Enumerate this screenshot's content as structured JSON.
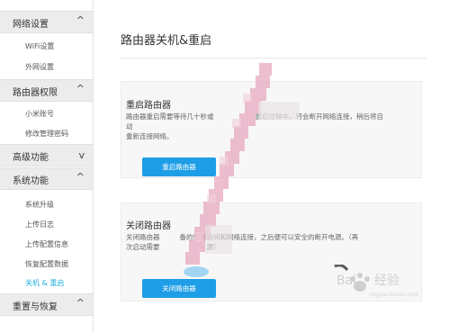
{
  "sidebar": {
    "sections": [
      {
        "label": "网络设置",
        "chevron": "^",
        "items": [
          "WiFi设置",
          "外网设置"
        ]
      },
      {
        "label": "路由器权限",
        "chevron": "^",
        "items": [
          "小米账号",
          "修改管理密码"
        ]
      },
      {
        "label": "高级功能",
        "chevron": "v",
        "items": []
      },
      {
        "label": "系统功能",
        "chevron": "^",
        "items": [
          "系统升级",
          "上传日志",
          "上传配置信息",
          "恢复配置数据",
          "关机 & 重启"
        ]
      },
      {
        "label": "重置与恢复",
        "chevron": "^",
        "items": []
      }
    ],
    "active_item": "关机 & 重启"
  },
  "main": {
    "title": "路由器关机&重启",
    "restart": {
      "title": "重启路由器",
      "desc_line1": "路由器重启需要等待几十秒或",
      "desc_line1b": "重启过程中，将会断开网络连接，稍后将自动",
      "desc_line2": "重新连接网络。",
      "button": "重启路由器"
    },
    "shutdown": {
      "title": "关闭路由器",
      "desc_line1a": "关闭路由器",
      "desc_line1b": "备的数据访问和网络连接，之后便可以安全的断开电源。（再",
      "desc_line2a": "次启动需要",
      "desc_line2b": "源）",
      "button": "关闭路由器"
    }
  },
  "watermark": {
    "text": "Bai 经验",
    "sub": "jingyan.baidu.com"
  },
  "colors": {
    "accent": "#1e9ee6",
    "active_link": "#22aee0",
    "smear": "#e7a9c0"
  }
}
